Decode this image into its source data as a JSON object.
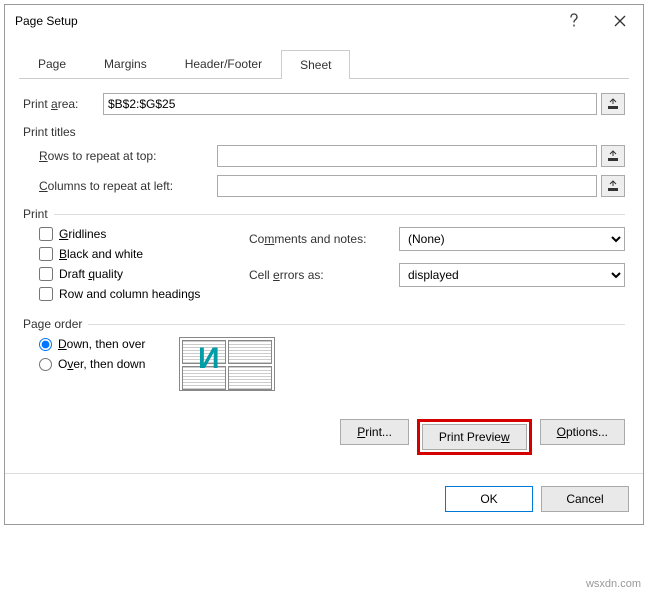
{
  "dialog": {
    "title": "Page Setup"
  },
  "tabs": {
    "page": "Page",
    "margins": "Margins",
    "headerfooter": "Header/Footer",
    "sheet": "Sheet"
  },
  "printArea": {
    "label": "Print area:",
    "value": "$B$2:$G$25"
  },
  "printTitles": {
    "group": "Print titles",
    "rows": "Rows to repeat at top:",
    "rowsValue": "",
    "cols": "Columns to repeat at left:",
    "colsValue": ""
  },
  "print": {
    "group": "Print",
    "gridlines": "Gridlines",
    "blackWhite": "Black and white",
    "draft": "Draft quality",
    "rowColHeadings": "Row and column headings",
    "commentsLabel": "Comments and notes:",
    "commentsValue": "(None)",
    "cellErrorsLabel": "Cell errors as:",
    "cellErrorsValue": "displayed"
  },
  "pageOrder": {
    "group": "Page order",
    "downOver": "Down, then over",
    "overDown": "Over, then down"
  },
  "buttons": {
    "print": "Print...",
    "preview": "Print Preview",
    "options": "Options...",
    "ok": "OK",
    "cancel": "Cancel"
  },
  "watermark": "wsxdn.com"
}
